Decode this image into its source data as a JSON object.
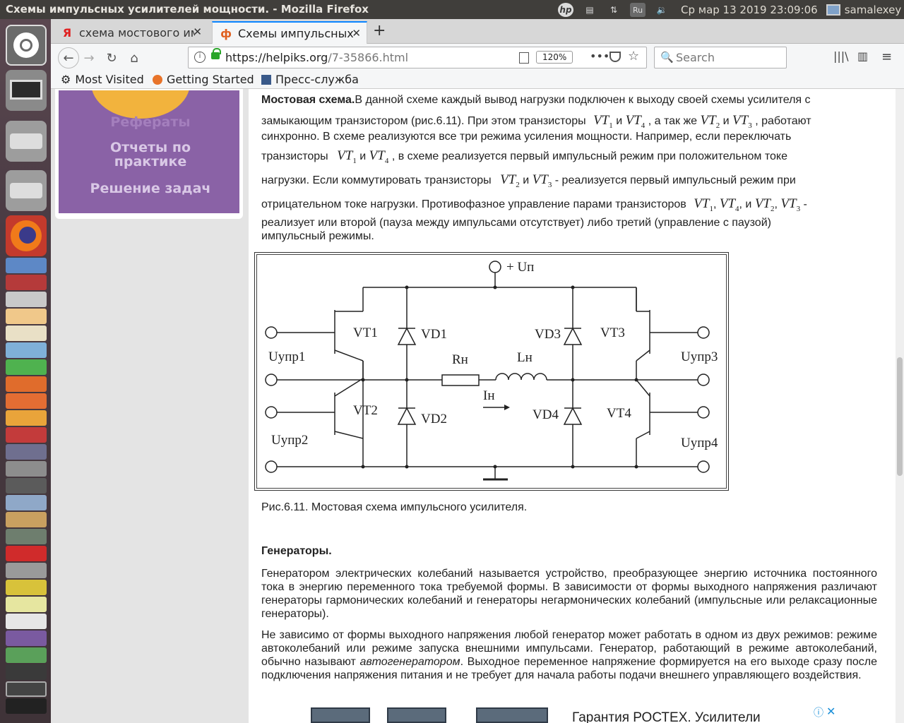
{
  "topbar": {
    "window_title": "Схемы импульсных усилителей мощности. - Mozilla Firefox",
    "lang": "Ru",
    "clock": "Ср мар 13 2019 23:09:06",
    "user": "samalexey"
  },
  "tabs": [
    {
      "label": "схема мостового им…",
      "favicon": "Я"
    },
    {
      "label": "Схемы импульсных …",
      "favicon": "ф"
    }
  ],
  "nav": {
    "url_host": "https://helpiks.org",
    "url_path": "/7-35866.html",
    "zoom": "120%",
    "search_placeholder": "Search"
  },
  "bookmarks": [
    {
      "label": "Most Visited"
    },
    {
      "label": "Getting Started"
    },
    {
      "label": "Пресс-служба"
    }
  ],
  "sidebar": {
    "item1": "Рефераты",
    "item2": "Отчеты по",
    "item2b": "практике",
    "item3": "Решение задач"
  },
  "article": {
    "p1_bold": "Мостовая схема.",
    "p1_l1": "В данной схеме каждый вывод нагрузки подключен к выходу своей схемы усилителя с",
    "p1_l2a": "замыкающим транзистором (рис.6.11). При этом транзисторы",
    "and": "и",
    "p1_l2b": ", а так же",
    "p1_l2c": ", работают",
    "p1_l3": "синхронно. В схеме реализуются все три режима усиления мощности. Например, если переключать",
    "p1_l4a": "транзисторы",
    "p1_l4b": ", в схеме реализуется первый импульсный режим при положительном токе",
    "p1_l5a": "нагрузки. Если коммутировать транзисторы",
    "p1_l5b": "- реализуется первый импульсный режим при",
    "p1_l6a": "отрицательном токе нагрузки. Противофазное управление парами транзисторов",
    "p1_l7": "реализует или второй (пауза между импульсами отсутствует) либо третий (управление с паузой)",
    "p1_l8": "импульсный режимы.",
    "vt1": "VT",
    "vt1s": "1",
    "vt4": "VT",
    "vt4s": "4",
    "vt2": "VT",
    "vt2s": "2",
    "vt3": "VT",
    "vt3s": "3",
    "caption": "Рис.6.11. Мостовая схема импульсного усилителя.",
    "h_gen": "Генераторы.",
    "p2": "Генератором электрических колебаний называется устройство, преобразующее энергию источника постоянного тока в энергию переменного тока требуемой формы. В зависимости от формы выходного напряжения различают генераторы гармонических колебаний и генераторы негармонических колебаний (импульсные или релаксационные генераторы).",
    "p3a": "Не зависимо от формы выходного напряжения любой генератор может работать в одном из двух режимов: режиме автоколебаний или режиме запуска внешними импульсами. Генератор, работающий в режиме автоколебаний, обычно называют ",
    "p3_em": "автогенератором",
    "p3b": ". Выходное переменное напряжение формируется на его выходе сразу после подключения напряжения питания и не требует для начала работы подачи внешнего управляющего воздействия.",
    "ad_text": "Гарантия РОСТЕХ. Усилители"
  },
  "diagram": {
    "up": "+ Uп",
    "vt1": "VT1",
    "vt2": "VT2",
    "vt3": "VT3",
    "vt4": "VT4",
    "vd1": "VD1",
    "vd2": "VD2",
    "vd3": "VD3",
    "vd4": "VD4",
    "rn": "Rн",
    "ln": "Lн",
    "in": "Iн",
    "u1": "Uупр1",
    "u2": "Uупр2",
    "u3": "Uупр3",
    "u4": "Uупр4"
  }
}
